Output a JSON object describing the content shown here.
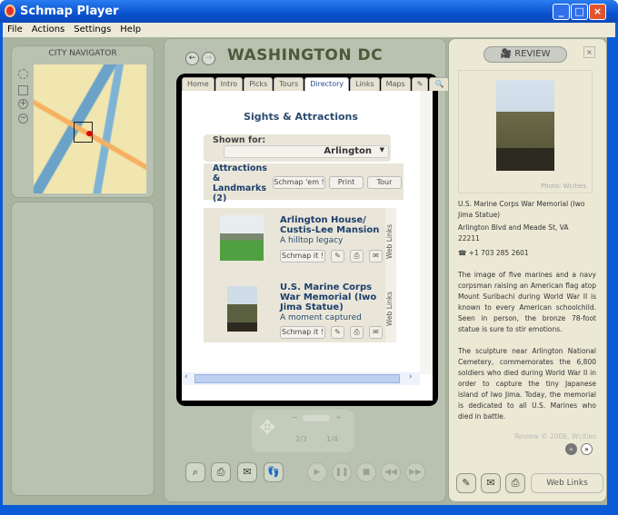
{
  "window": {
    "title": "Schmap Player",
    "controls": [
      "_",
      "□",
      "×"
    ]
  },
  "menu": [
    "File",
    "Actions",
    "Settings",
    "Help"
  ],
  "navigator": {
    "title": "CITY NAVIGATOR"
  },
  "center": {
    "title": "WASHINGTON DC",
    "tabs": [
      "Home",
      "Intro",
      "Picks",
      "Tours",
      "Directory",
      "Links",
      "Maps",
      "✎",
      "🔍"
    ],
    "active_tab": "Directory",
    "section_title": "Sights & Attractions",
    "shown_for_label": "Shown for:",
    "shown_for_value": "Arlington",
    "category": "Attractions & Landmarks (2)",
    "buttons": {
      "schmap_em": "Schmap 'em !",
      "print": "Print",
      "tour": "Tour"
    },
    "items": [
      {
        "title": "Arlington House/ Custis-Lee Mansion",
        "subtitle": "A hilltop legacy",
        "schmap": "Schmap it !",
        "web_links": "Web Links"
      },
      {
        "title": "U.S. Marine Corps War Memorial (Iwo Jima Statue)",
        "subtitle": "A moment captured",
        "schmap": "Schmap it !",
        "web_links": "Web Links"
      }
    ],
    "zoom_labels": {
      "minus": "−",
      "plus": "+",
      "angle": "2/3",
      "page": "1/4"
    }
  },
  "review": {
    "button": "REVIEW",
    "photo_credit": "Photo: Wcities",
    "name": "U.S. Marine Corps War Memorial (Iwo Jima Statue)",
    "address": "Arlington Blvd and Meade St, VA 22211",
    "phone": "+1 703 285 2601",
    "paragraph1": "The image of five marines and a navy corpsman raising an American flag atop Mount Suribachi during World War II is known to every American schoolchild. Seen in person, the bronze 78-foot statue is sure to stir emotions.",
    "paragraph2": "The sculpture near Arlington National Cemetery, commemorates the 6,800 soldiers who died during World War II in order to capture the tiny Japanese island of Iwo Jima. Today, the memorial is dedicated to all U.S. Marines who died in battle.",
    "copyright": "Review © 2006, Wcities",
    "web_links": "Web Links"
  }
}
